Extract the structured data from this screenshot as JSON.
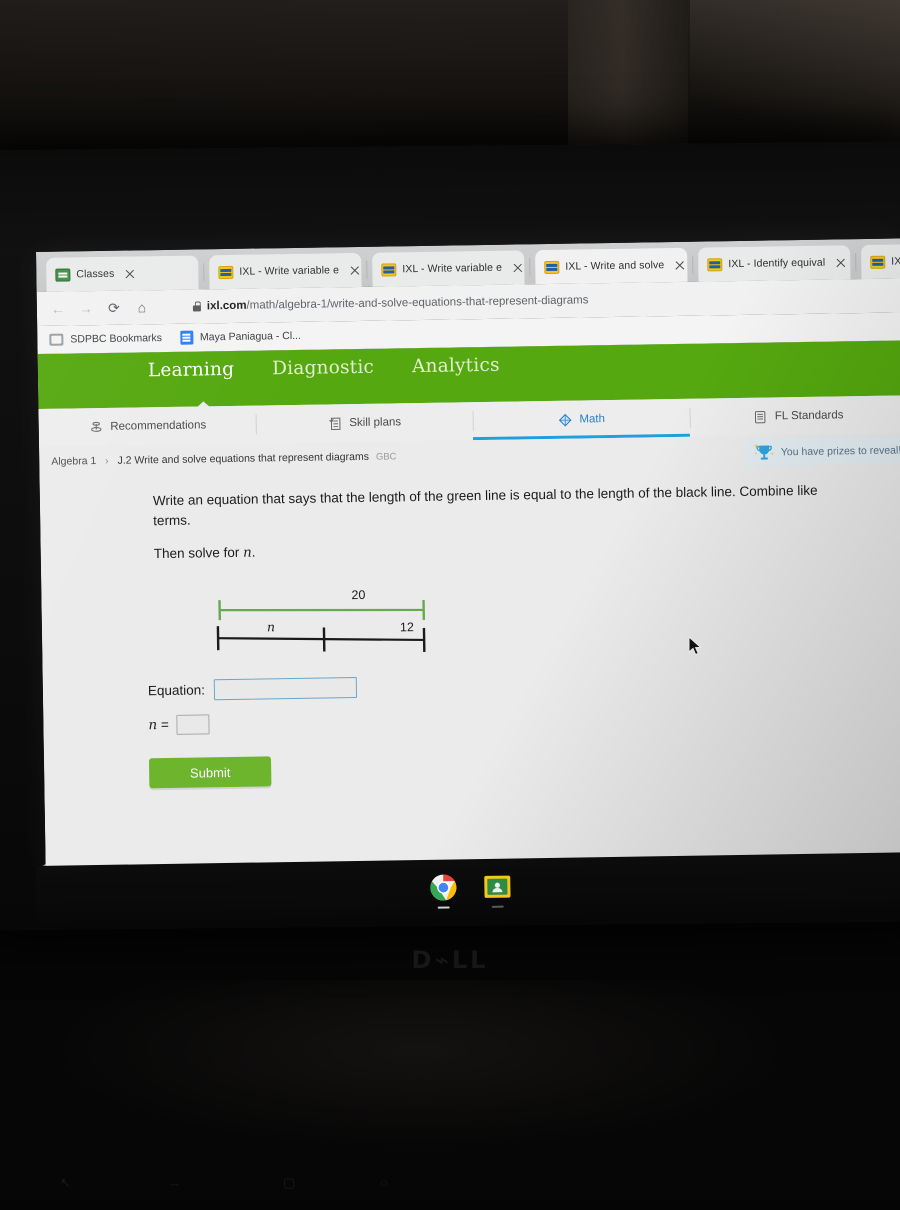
{
  "browser": {
    "tabs": [
      {
        "title": "Classes",
        "title_fade": "",
        "favicon": "classroom-icon",
        "active": false
      },
      {
        "title": "IXL - Write variable e",
        "title_fade": "",
        "favicon": "ixl-icon",
        "active": false
      },
      {
        "title": "IXL - Write variable e",
        "title_fade": "",
        "favicon": "ixl-icon",
        "active": false
      },
      {
        "title": "IXL - Write and solve",
        "title_fade": "",
        "favicon": "ixl-icon",
        "active": true
      },
      {
        "title": "IXL - Identify equival",
        "title_fade": "",
        "favicon": "ixl-icon",
        "active": false
      },
      {
        "title": "IXL",
        "title_fade": "",
        "favicon": "ixl-icon",
        "active": false
      }
    ],
    "nav": {
      "back": "←",
      "forward": "→",
      "reload": "⟳",
      "home": "⌂"
    },
    "omnibox": {
      "lock": "lock-icon",
      "url_domain": "ixl.com",
      "url_path": "/math/algebra-1/write-and-solve-equations-that-represent-diagrams"
    },
    "bookmarks": [
      {
        "label": "SDPBC Bookmarks",
        "icon": "folder-icon"
      },
      {
        "label": "Maya Paniagua - Cl...",
        "icon": "doc-icon"
      }
    ]
  },
  "ixl": {
    "green_nav": [
      {
        "label": "Learning",
        "active": true
      },
      {
        "label": "Diagnostic",
        "active": false
      },
      {
        "label": "Analytics",
        "active": false
      }
    ],
    "subnav": [
      {
        "label": "Recommendations",
        "icon": "recommendations-icon",
        "active": false
      },
      {
        "label": "Skill plans",
        "icon": "skill-plans-icon",
        "active": false
      },
      {
        "label": "Math",
        "icon": "math-icon",
        "active": true
      },
      {
        "label": "FL Standards",
        "icon": "standards-icon",
        "active": false
      }
    ],
    "breadcrumb": {
      "course": "Algebra 1",
      "separator": "›",
      "skill": "J.2 Write and solve equations that represent diagrams",
      "code": "GBC"
    },
    "prizes": {
      "label": "You have prizes to reveal!",
      "icon": "trophy-icon"
    },
    "question": {
      "line1": "Write an equation that says that the length of the green line is equal to the length of the black line. Combine like terms.",
      "line2_prefix": "Then solve for ",
      "line2_var": "n",
      "line2_suffix": "."
    },
    "diagram": {
      "green_label": "20",
      "black_label_left": "n",
      "black_label_right": "12",
      "green_color": "#6aa84f",
      "black_color": "#1a1a1a"
    },
    "answer": {
      "equation_label": "Equation:",
      "equation_value": "",
      "equation_placeholder": "",
      "n_label": "n =",
      "n_value": "",
      "n_placeholder": "",
      "submit_label": "Submit"
    },
    "colors": {
      "green_bar": "#55a80f",
      "submit_green": "#6cb52d",
      "active_blue": "#1f9fe0"
    }
  },
  "shelf": {
    "icons": [
      {
        "name": "chrome-icon"
      },
      {
        "name": "google-classroom-icon"
      }
    ]
  },
  "device": {
    "brand": "D⌁LL",
    "webcam": "webcam-icon"
  }
}
